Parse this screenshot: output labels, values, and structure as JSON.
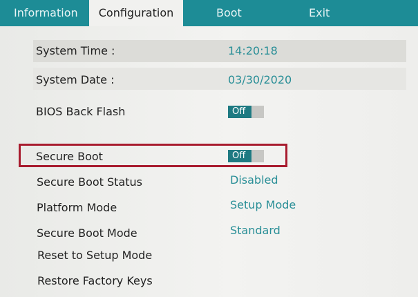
{
  "tabs": [
    {
      "label": "Information"
    },
    {
      "label": "Configuration",
      "active": true
    },
    {
      "label": "Boot"
    },
    {
      "label": "Exit"
    }
  ],
  "settings": {
    "system_time": {
      "label": "System Time :",
      "value": "14:20:18"
    },
    "system_date": {
      "label": "System Date :",
      "value": "03/30/2020"
    },
    "bios_back_flash": {
      "label": "BIOS Back Flash",
      "value": "Off"
    },
    "secure_boot": {
      "label": "Secure Boot",
      "value": "Off"
    },
    "secure_boot_status": {
      "label": "Secure Boot Status",
      "value": "Disabled"
    },
    "platform_mode": {
      "label": "Platform Mode",
      "value": "Setup Mode"
    },
    "secure_boot_mode": {
      "label": "Secure Boot Mode",
      "value": "Standard"
    },
    "reset_to_setup_mode": {
      "label": "Reset to Setup Mode"
    },
    "restore_factory_keys": {
      "label": "Restore Factory Keys"
    }
  },
  "colors": {
    "tab_bar": "#1d8c96",
    "value_text": "#2a8f97",
    "toggle_on": "#1e7a82",
    "focus_border": "#a81b2e"
  }
}
